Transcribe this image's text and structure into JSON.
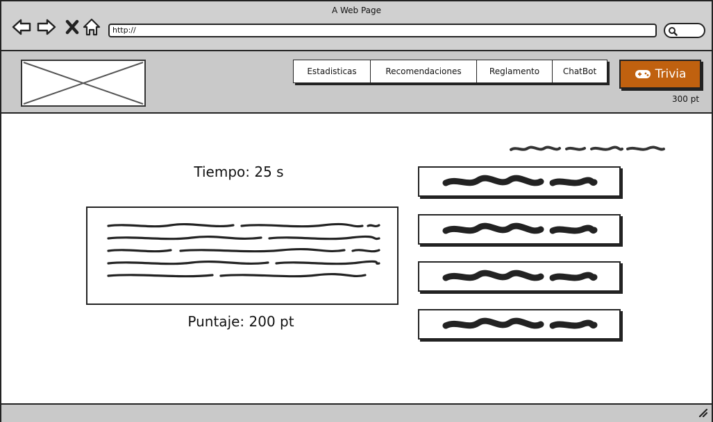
{
  "window": {
    "title": "A Web Page"
  },
  "browser": {
    "url": "http://",
    "icons": [
      "back-icon",
      "forward-icon",
      "close-icon",
      "home-icon",
      "search-icon"
    ]
  },
  "header": {
    "logo": "image-placeholder",
    "nav": [
      {
        "label": "Estadisticas"
      },
      {
        "label": "Recomendaciones"
      },
      {
        "label": "Reglamento"
      },
      {
        "label": "ChatBot"
      }
    ],
    "trivia_label": "Trivia",
    "trivia_icon": "gamepad-icon",
    "points": "300 pt"
  },
  "game": {
    "timer": "Tiempo: 25 s",
    "score": "Puntaje: 200 pt",
    "answers_count_label": ""
  },
  "colors": {
    "accent": "#c0610f",
    "chrome": "#d0d0d0",
    "band": "#c9c9c9",
    "ink": "#222222"
  }
}
